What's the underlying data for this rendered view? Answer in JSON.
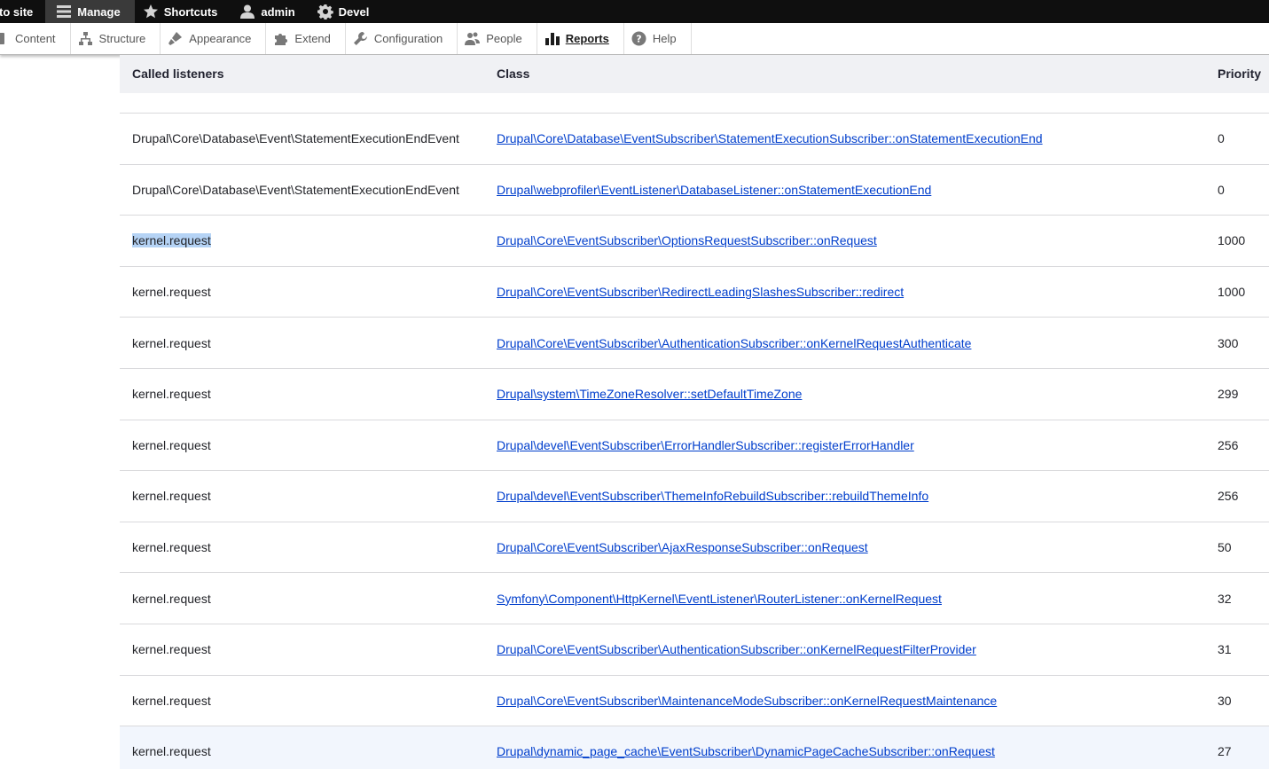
{
  "toolbar": {
    "back_label": "to site",
    "manage_label": "Manage",
    "shortcuts_label": "Shortcuts",
    "user_label": "admin",
    "devel_label": "Devel"
  },
  "tray": {
    "items": [
      {
        "label": "Content",
        "icon": "content-icon"
      },
      {
        "label": "Structure",
        "icon": "structure-icon"
      },
      {
        "label": "Appearance",
        "icon": "appearance-icon"
      },
      {
        "label": "Extend",
        "icon": "extend-icon"
      },
      {
        "label": "Configuration",
        "icon": "wrench-icon"
      },
      {
        "label": "People",
        "icon": "people-icon"
      },
      {
        "label": "Reports",
        "icon": "reports-icon",
        "active": true
      },
      {
        "label": "Help",
        "icon": "help-icon"
      }
    ]
  },
  "table": {
    "headers": {
      "listener": "Called listeners",
      "class": "Class",
      "priority": "Priority"
    },
    "rows": [
      {
        "event": "Drupal\\Core\\Database\\Event\\StatementExecutionEndEvent",
        "class": "Drupal\\Core\\Database\\EventSubscriber\\StatementExecutionSubscriber::onStatementExecutionEnd",
        "priority": "0"
      },
      {
        "event": "Drupal\\Core\\Database\\Event\\StatementExecutionEndEvent",
        "class": "Drupal\\webprofiler\\EventListener\\DatabaseListener::onStatementExecutionEnd",
        "priority": "0"
      },
      {
        "event": "kernel.request",
        "class": "Drupal\\Core\\EventSubscriber\\OptionsRequestSubscriber::onRequest",
        "priority": "1000"
      },
      {
        "event": "kernel.request",
        "class": "Drupal\\Core\\EventSubscriber\\RedirectLeadingSlashesSubscriber::redirect",
        "priority": "1000"
      },
      {
        "event": "kernel.request",
        "class": "Drupal\\Core\\EventSubscriber\\AuthenticationSubscriber::onKernelRequestAuthenticate",
        "priority": "300"
      },
      {
        "event": "kernel.request",
        "class": "Drupal\\system\\TimeZoneResolver::setDefaultTimeZone",
        "priority": "299"
      },
      {
        "event": "kernel.request",
        "class": "Drupal\\devel\\EventSubscriber\\ErrorHandlerSubscriber::registerErrorHandler",
        "priority": "256"
      },
      {
        "event": "kernel.request",
        "class": "Drupal\\devel\\EventSubscriber\\ThemeInfoRebuildSubscriber::rebuildThemeInfo",
        "priority": "256"
      },
      {
        "event": "kernel.request",
        "class": "Drupal\\Core\\EventSubscriber\\AjaxResponseSubscriber::onRequest",
        "priority": "50"
      },
      {
        "event": "kernel.request",
        "class": "Symfony\\Component\\HttpKernel\\EventListener\\RouterListener::onKernelRequest",
        "priority": "32"
      },
      {
        "event": "kernel.request",
        "class": "Drupal\\Core\\EventSubscriber\\AuthenticationSubscriber::onKernelRequestFilterProvider",
        "priority": "31"
      },
      {
        "event": "kernel.request",
        "class": "Drupal\\Core\\EventSubscriber\\MaintenanceModeSubscriber::onKernelRequestMaintenance",
        "priority": "30"
      },
      {
        "event": "kernel.request",
        "class": "Drupal\\dynamic_page_cache\\EventSubscriber\\DynamicPageCacheSubscriber::onRequest",
        "priority": "27"
      }
    ],
    "selected_row": 2,
    "highlighted_row": 12
  }
}
